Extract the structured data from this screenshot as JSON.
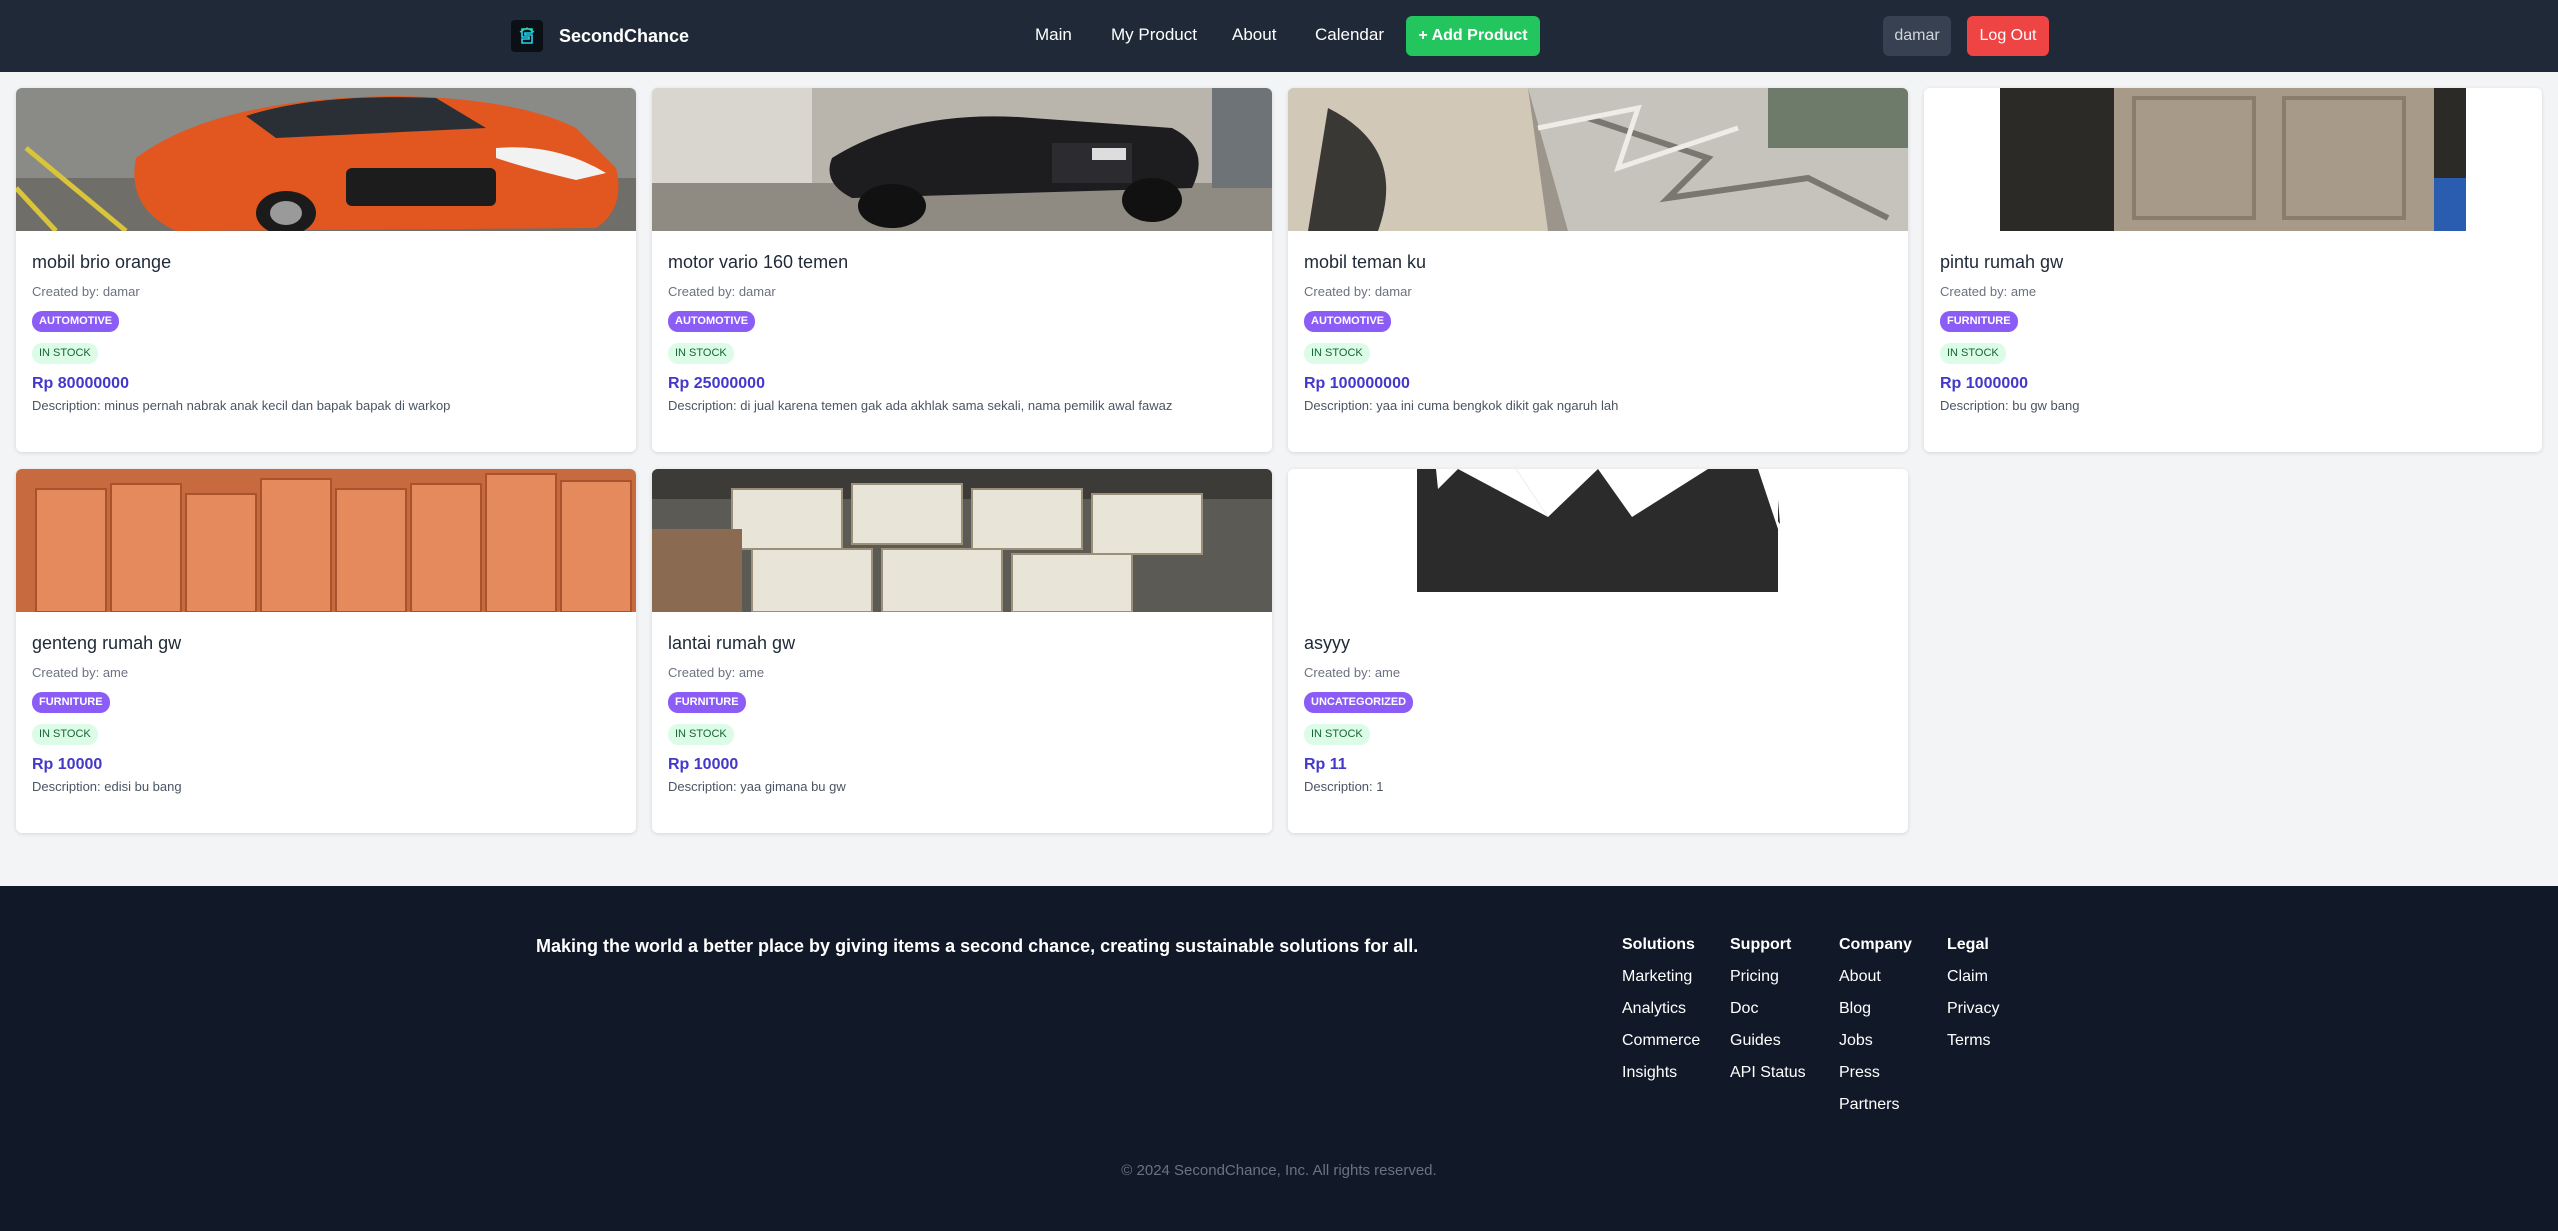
{
  "navbar": {
    "brand": "SecondChance",
    "links": [
      "Main",
      "My Product",
      "About",
      "Calendar"
    ],
    "add_button": "+ Add Product",
    "username": "damar",
    "logout": "Log Out",
    "colors": {
      "bg": "#1f2937",
      "add": "#22c55e",
      "logout": "#ef4444"
    }
  },
  "products": [
    {
      "title": "mobil brio orange",
      "creator": "Created by: damar",
      "category": "AUTOMOTIVE",
      "stock": "IN STOCK",
      "price": "Rp 80000000",
      "description": "Description: minus pernah nabrak anak kecil dan bapak bapak di warkop",
      "image": "orange-car-photo"
    },
    {
      "title": "motor vario 160 temen",
      "creator": "Created by: damar",
      "category": "AUTOMOTIVE",
      "stock": "IN STOCK",
      "price": "Rp 25000000",
      "description": "Description: di jual karena temen gak ada akhlak sama sekali, nama pemilik awal fawaz",
      "image": "black-scooter-photo"
    },
    {
      "title": "mobil teman ku",
      "creator": "Created by: damar",
      "category": "AUTOMOTIVE",
      "stock": "IN STOCK",
      "price": "Rp 100000000",
      "description": "Description: yaa ini cuma bengkok dikit gak ngaruh lah",
      "image": "crashed-car-photo"
    },
    {
      "title": "pintu rumah gw",
      "creator": "Created by: ame",
      "category": "FURNITURE",
      "stock": "IN STOCK",
      "price": "Rp 1000000",
      "description": "Description: bu gw bang",
      "image": "wooden-door-photo"
    },
    {
      "title": "genteng rumah gw",
      "creator": "Created by: ame",
      "category": "FURNITURE",
      "stock": "IN STOCK",
      "price": "Rp 10000",
      "description": "Description: edisi bu bang",
      "image": "roof-tiles-photo"
    },
    {
      "title": "lantai rumah gw",
      "creator": "Created by: ame",
      "category": "FURNITURE",
      "stock": "IN STOCK",
      "price": "Rp 10000",
      "description": "Description: yaa gimana bu gw",
      "image": "floor-tiles-photo"
    },
    {
      "title": "asyyy",
      "creator": "Created by: ame",
      "category": "UNCATEGORIZED",
      "stock": "IN STOCK",
      "price": "Rp 11",
      "description": "Description: 1",
      "image": "dark-shape-image"
    }
  ],
  "footer": {
    "tagline": "Making the world a better place by giving items a second chance, creating sustainable solutions for all.",
    "columns": [
      {
        "title": "Solutions",
        "items": [
          "Marketing",
          "Analytics",
          "Commerce",
          "Insights"
        ]
      },
      {
        "title": "Support",
        "items": [
          "Pricing",
          "Doc",
          "Guides",
          "API Status"
        ]
      },
      {
        "title": "Company",
        "items": [
          "About",
          "Blog",
          "Jobs",
          "Press",
          "Partners"
        ]
      },
      {
        "title": "Legal",
        "items": [
          "Claim",
          "Privacy",
          "Terms"
        ]
      }
    ],
    "copyright": "© 2024 SecondChance, Inc. All rights reserved."
  }
}
